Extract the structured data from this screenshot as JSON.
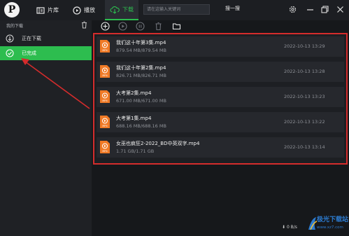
{
  "app": {
    "logo_letter": "P"
  },
  "nav": {
    "library": "片库",
    "play": "播放",
    "download": "下载",
    "search_placeholder": "请在这输入关键词",
    "search_button": "搜一搜"
  },
  "sidebar": {
    "header": "我的下载",
    "items": [
      {
        "label": "正在下载",
        "icon": "download-arrow-icon"
      },
      {
        "label": "已完成",
        "icon": "check-circle-icon"
      }
    ]
  },
  "toolbar": {
    "icons": [
      "add-icon",
      "play-icon",
      "pause-icon",
      "delete-icon",
      "folder-icon"
    ]
  },
  "files": [
    {
      "name": "我们这十年第3集.mp4",
      "size": "879.54 MB/879.54 MB",
      "date": "2022-10-13 13:29"
    },
    {
      "name": "我们这十年第2集.mp4",
      "size": "826.71 MB/826.71 MB",
      "date": "2022-10-13 13:28"
    },
    {
      "name": "大考第2集.mp4",
      "size": "671.00 MB/671.00 MB",
      "date": "2022-10-13 13:23"
    },
    {
      "name": "大考第1集.mp4",
      "size": "688.16 MB/688.16 MB",
      "date": "2022-10-13 13:22"
    },
    {
      "name": "女巫也疯狂2-2022_BD中英双字.mp4",
      "size": "1.71 GB/1.71 GB",
      "date": "2022-10-13 13:14"
    }
  ],
  "file_icon_label": "MP4",
  "status": {
    "speed": "0 B/s"
  },
  "watermark": {
    "text": "极光下载站",
    "url": "www.xz7.com"
  },
  "colors": {
    "accent": "#2dbd4f",
    "highlight_border": "#d42c2c",
    "file_icon": "#f07a26"
  }
}
